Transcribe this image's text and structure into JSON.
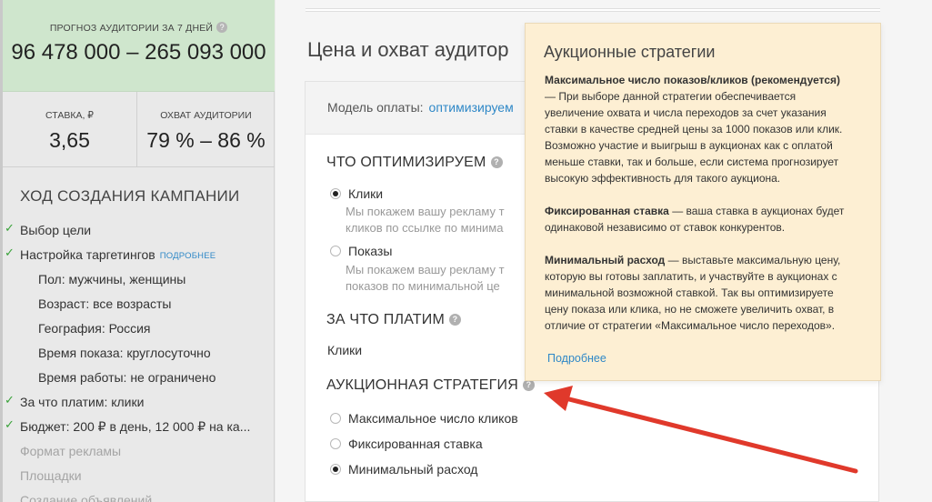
{
  "sidebar": {
    "forecast_title": "ПРОГНОЗ АУДИТОРИИ ЗА 7 ДНЕЙ",
    "forecast_value": "96 478 000 – 265 093 000",
    "bid_label": "СТАВКА, ₽",
    "bid_value": "3,65",
    "reach_label": "ОХВАТ АУДИТОРИИ",
    "reach_value": "79 % – 86 %",
    "progress_title": "ХОД СОЗДАНИЯ КАМПАНИИ",
    "steps": [
      {
        "label": "Выбор цели"
      },
      {
        "label": "Настройка таргетингов",
        "more": "ПОДРОБНЕЕ"
      },
      {
        "label": "Пол: мужчины, женщины"
      },
      {
        "label": "Возраст: все возрасты"
      },
      {
        "label": "География: Россия"
      },
      {
        "label": "Время показа: круглосуточно"
      },
      {
        "label": "Время работы: не ограничено"
      },
      {
        "label": "За что платим: клики"
      },
      {
        "label": "Бюджет: 200 ₽ в день, 12 000 ₽ на ка..."
      },
      {
        "label": "Формат рекламы"
      },
      {
        "label": "Площадки"
      },
      {
        "label": "Создание объявлений"
      }
    ]
  },
  "main": {
    "page_title": "Цена и охват аудитор",
    "pay_label": "Модель оплаты:",
    "pay_value": "оптимизируем",
    "optimize_title": "ЧТО ОПТИМИЗИРУЕМ",
    "clicks_label": "Клики",
    "clicks_desc_1": "Мы покажем вашу рекламу т",
    "clicks_desc_2": "кликов по ссылке по минима",
    "shows_label": "Показы",
    "shows_desc_1": "Мы покажем вашу рекламу т",
    "shows_desc_2": "показов по минимальной це",
    "pay_for_title": "ЗА ЧТО ПЛАТИМ",
    "pay_for_value": "Клики",
    "auction_title": "АУКЦИОННАЯ СТРАТЕГИЯ",
    "strategies": [
      "Максимальное число кликов",
      "Фиксированная ставка",
      "Минимальный расход"
    ]
  },
  "tooltip": {
    "title": "Аукционные стратегии",
    "p1_bold": "Максимальное число показов/кликов (рекомендуется)",
    "p1_lines": [
      "— При выборе данной стратегии обеспечивается",
      "увеличение охвата и числа переходов за счет указания",
      "ставки в качестве средней цены за 1000 показов или клик.",
      "Возможно участие и выигрыш в аукционах как с оплатой",
      "меньше ставки, так и больше, если система прогнозирует",
      "высокую эффективность для такого аукциона."
    ],
    "p2_bold": "Фиксированная ставка",
    "p2_first": " — ваша ставка в аукционах будет",
    "p2_second": "одинаковой независимо от ставок конкурентов.",
    "p3_bold": "Минимальный расход",
    "p3_first": " — выставьте максимальную цену,",
    "p3_lines": [
      "которую вы готовы заплатить, и участвуйте в аукционах с",
      "минимальной возможной ставкой. Так вы оптимизируете",
      "цену показа или клика, но не сможете увеличить охват,  в",
      "отличие от стратегии «Максимальное число переходов»."
    ],
    "more": "Подробнее"
  },
  "colors": {
    "accent": "#2f88c7",
    "arrow": "#e0392b",
    "tooltip_bg": "#fdefd3",
    "forecast_bg": "#cfe6cd",
    "check": "#3aa23a"
  }
}
